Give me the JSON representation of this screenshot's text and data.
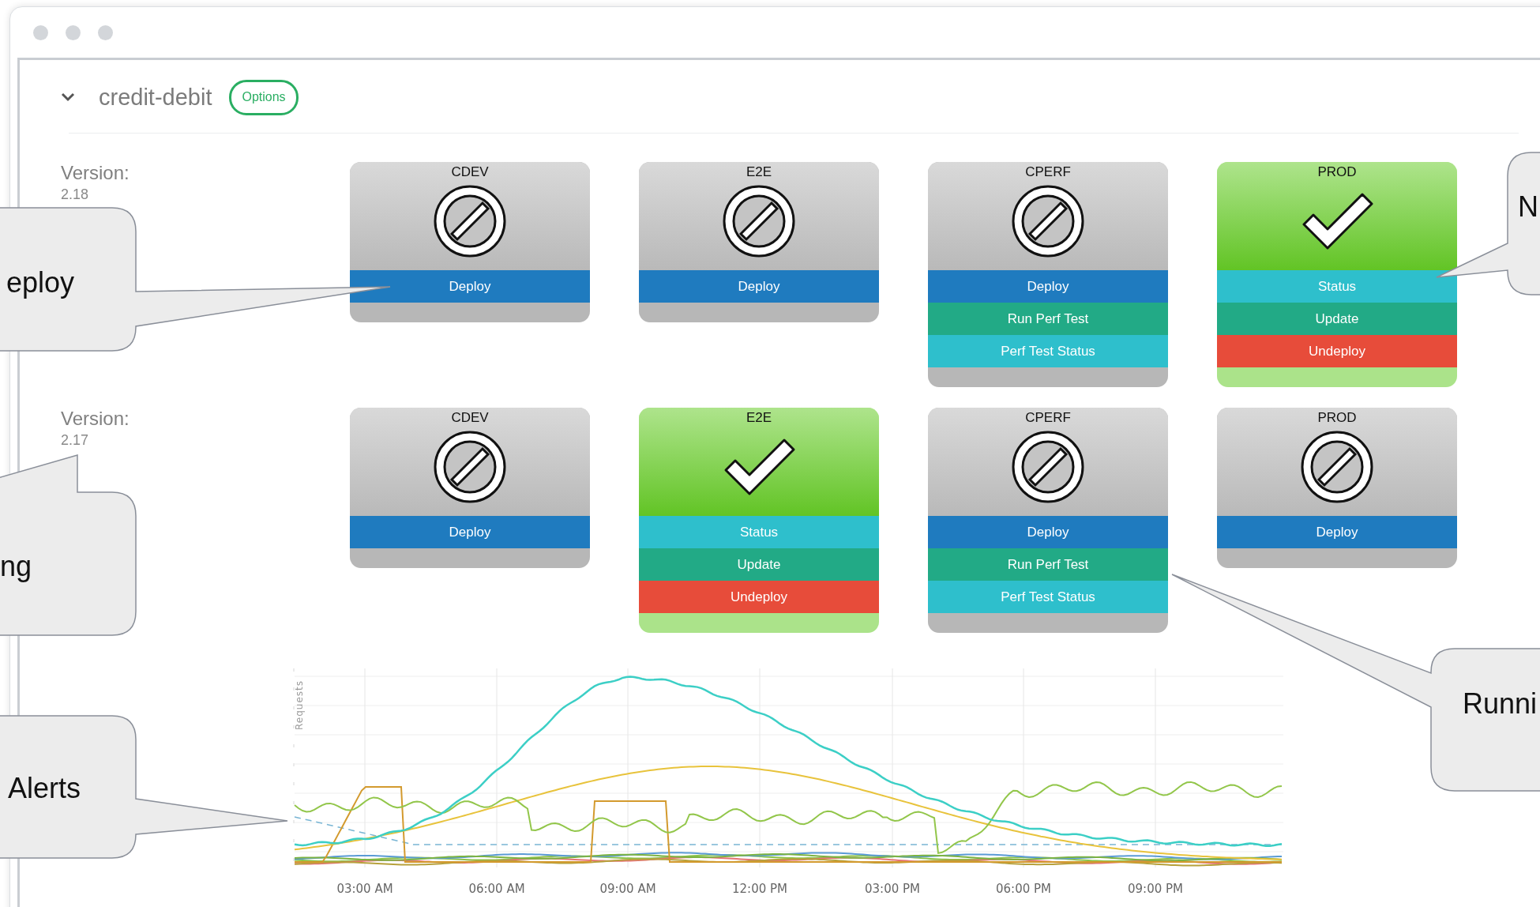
{
  "app": {
    "title": "credit-debit",
    "expanded": true,
    "options_button": "Options"
  },
  "versions": [
    {
      "label": "Version:",
      "number": "2.18",
      "environments": [
        {
          "name": "CDEV",
          "deployed": false,
          "actions": [
            {
              "label": "Deploy",
              "kind": "deploy"
            }
          ]
        },
        {
          "name": "E2E",
          "deployed": false,
          "actions": [
            {
              "label": "Deploy",
              "kind": "deploy"
            }
          ]
        },
        {
          "name": "CPERF",
          "deployed": false,
          "actions": [
            {
              "label": "Deploy",
              "kind": "deploy"
            },
            {
              "label": "Run Perf Test",
              "kind": "perf"
            },
            {
              "label": "Perf Test Status",
              "kind": "status"
            }
          ]
        },
        {
          "name": "PROD",
          "deployed": true,
          "actions": [
            {
              "label": "Status",
              "kind": "status"
            },
            {
              "label": "Update",
              "kind": "update"
            },
            {
              "label": "Undeploy",
              "kind": "undeploy"
            }
          ]
        }
      ]
    },
    {
      "label": "Version:",
      "number": "2.17",
      "environments": [
        {
          "name": "CDEV",
          "deployed": false,
          "actions": [
            {
              "label": "Deploy",
              "kind": "deploy"
            }
          ]
        },
        {
          "name": "E2E",
          "deployed": true,
          "actions": [
            {
              "label": "Status",
              "kind": "status"
            },
            {
              "label": "Update",
              "kind": "update"
            },
            {
              "label": "Undeploy",
              "kind": "undeploy"
            }
          ]
        },
        {
          "name": "CPERF",
          "deployed": false,
          "actions": [
            {
              "label": "Deploy",
              "kind": "deploy"
            },
            {
              "label": "Run Perf Test",
              "kind": "perf"
            },
            {
              "label": "Perf Test Status",
              "kind": "status"
            }
          ]
        },
        {
          "name": "PROD",
          "deployed": false,
          "actions": [
            {
              "label": "Deploy",
              "kind": "deploy"
            }
          ]
        }
      ]
    }
  ],
  "chart": {
    "y_label": "Requests",
    "x_labels": [
      "03:00 AM",
      "06:00 AM",
      "09:00 AM",
      "12:00 PM",
      "03:00 PM",
      "06:00 PM",
      "09:00 PM"
    ]
  },
  "callouts": [
    {
      "text": "eploy"
    },
    {
      "text": "N"
    },
    {
      "text": "ng"
    },
    {
      "text": "Runni"
    },
    {
      "text": "Alerts"
    }
  ]
}
